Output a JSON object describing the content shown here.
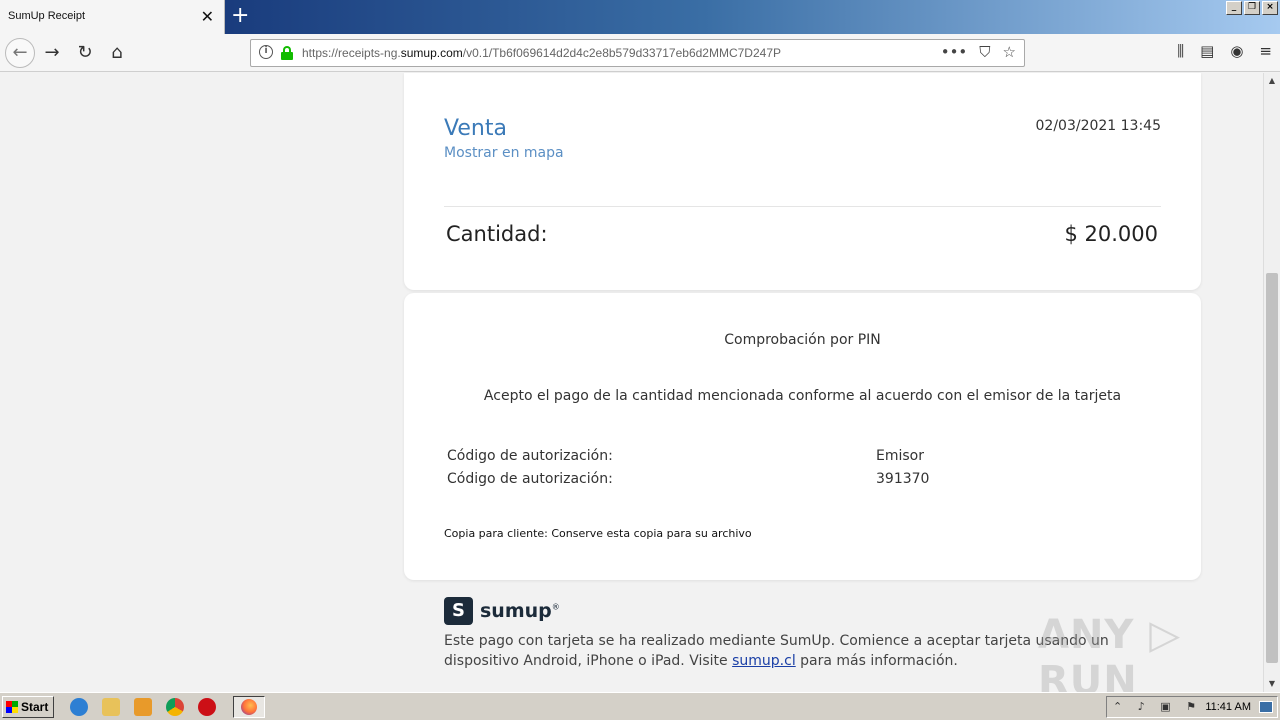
{
  "browser": {
    "tab_title": "SumUp Receipt",
    "tab_close": "✕",
    "new_tab": "+",
    "url_scheme": "https://receipts-ng.",
    "url_domain": "sumup.com",
    "url_path": "/v0.1/Tb6f069614d2d4c2e8b579d33717eb6d2MMC7D247P"
  },
  "receipt": {
    "title": "Venta",
    "map_link": "Mostrar en mapa",
    "datetime": "02/03/2021 13:45",
    "amount_label": "Cantidad:",
    "amount_value": "$ 20.000",
    "pin_title": "Comprobación por PIN",
    "accept_text": "Acepto el pago de la cantidad mencionada conforme al acuerdo con el emisor de la tarjeta",
    "rows": [
      {
        "label": "Código de autorización:",
        "value": "Emisor"
      },
      {
        "label": "Código de autorización:",
        "value": "391370"
      }
    ],
    "copy_note": "Copia para cliente: Conserve esta copia para su archivo"
  },
  "footer": {
    "logo_text": "sumup",
    "text_before": "Este pago con tarjeta se ha realizado mediante SumUp. Comience a aceptar tarjeta usando un dispositivo Android, iPhone o iPad. Visite ",
    "link": "sumup.cl",
    "text_after": " para más información."
  },
  "taskbar": {
    "start_label": "Start",
    "clock": "11:41 AM"
  },
  "colors": {
    "accent_blue": "#3b7ab8",
    "logo_dark": "#1c2b3a"
  }
}
